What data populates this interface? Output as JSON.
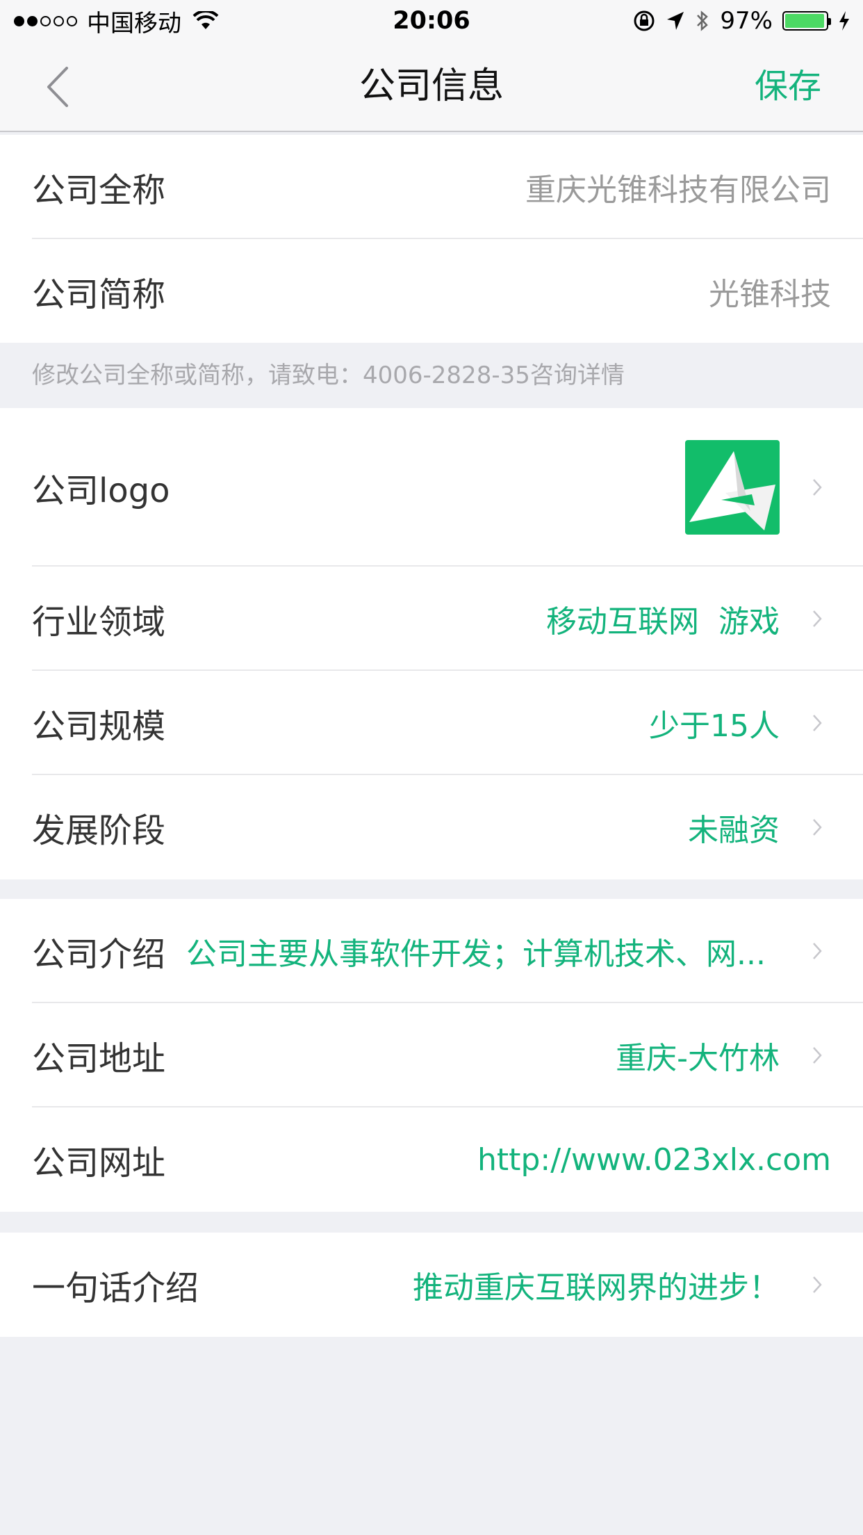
{
  "status_bar": {
    "carrier": "中国移动",
    "time": "20:06",
    "battery": "97%",
    "battery_level": 0.97
  },
  "nav": {
    "title": "公司信息",
    "save_label": "保存"
  },
  "names": {
    "full_name_label": "公司全称",
    "full_name_value": "重庆光锥科技有限公司",
    "short_name_label": "公司简称",
    "short_name_value": "光锥科技"
  },
  "hint": "修改公司全称或简称，请致电：4006-2828-35咨询详情",
  "profile": {
    "logo_label": "公司logo",
    "industry_label": "行业领域",
    "industry_value": "移动互联网  游戏",
    "size_label": "公司规模",
    "size_value": "少于15人",
    "stage_label": "发展阶段",
    "stage_value": "未融资"
  },
  "details": {
    "intro_label": "公司介绍",
    "intro_value": "公司主要从事软件开发；计算机技术、网...",
    "address_label": "公司地址",
    "address_value": "重庆-大竹林",
    "website_label": "公司网址",
    "website_value": "http://www.023xlx.com"
  },
  "slogan": {
    "label": "一句话介绍",
    "value": "推动重庆互联网界的进步！"
  },
  "colors": {
    "accent": "#13b37c",
    "logo_bg": "#12bd6a",
    "page_bg": "#eff0f4"
  }
}
